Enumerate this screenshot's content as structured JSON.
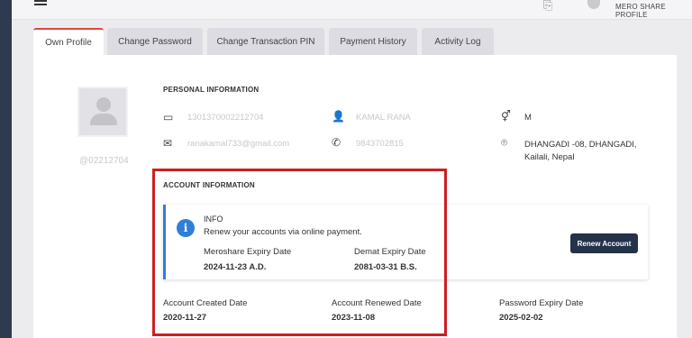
{
  "header": {
    "user_label": "MERO SHARE PROFILE"
  },
  "tabs": [
    "Own Profile",
    "Change Password",
    "Change Transaction PIN",
    "Payment History",
    "Activity Log"
  ],
  "profile": {
    "id": "@02212704"
  },
  "personal": {
    "title": "PERSONAL INFORMATION",
    "boid": "1301370002212704",
    "name": "KAMAL RANA",
    "gender": "M",
    "email": "ranakamal733@gmail.com",
    "phone": "9843702815",
    "address": "DHANGADI -08, DHANGADI, Kailali, Nepal"
  },
  "account": {
    "title": "ACCOUNT INFORMATION",
    "info_heading": "INFO",
    "info_text": "Renew your accounts via online payment.",
    "meroshare_expiry_label": "Meroshare Expiry Date",
    "meroshare_expiry": "2024-11-23 A.D.",
    "demat_expiry_label": "Demat Expiry Date",
    "demat_expiry": "2081-03-31 B.S.",
    "renew_button": "Renew Account",
    "created_label": "Account Created Date",
    "created": "2020-11-27",
    "renewed_label": "Account Renewed Date",
    "renewed": "2023-11-08",
    "pwd_expiry_label": "Password Expiry Date",
    "pwd_expiry": "2025-02-02"
  },
  "colors": {
    "accent_blue": "#2f7fd6",
    "highlight_red": "#cc1f1f",
    "button_dark": "#24324a"
  }
}
